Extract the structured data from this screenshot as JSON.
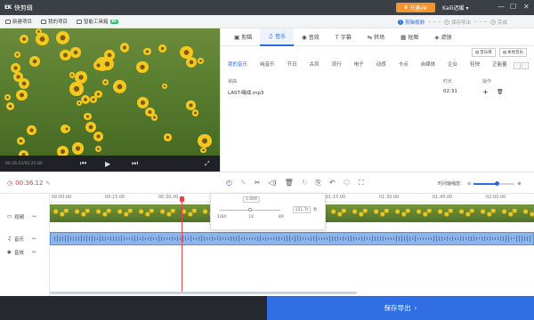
{
  "app": {
    "logo_text": "EK",
    "name": "快剪辑",
    "vip_label": "开通VIP",
    "user_name": "Kaili迟缓",
    "minimize": "—",
    "maximize": "☐",
    "close": "✕"
  },
  "toolbar": {
    "new_project": "新建项目",
    "my_projects": "我的项目",
    "smart_toolbox": "智能工具箱",
    "ai_badge": "AI"
  },
  "steps": [
    {
      "num": "1",
      "label": "剪辑视频",
      "active": true
    },
    {
      "num": "2",
      "label": "保存导出",
      "active": false
    },
    {
      "num": "3",
      "label": "完成",
      "active": false
    }
  ],
  "preview": {
    "timecode": "00:36.12/03:25.80"
  },
  "panel": {
    "tabs": [
      {
        "icon": "▣",
        "label": "剪辑",
        "active": false
      },
      {
        "icon": "♫",
        "label": "音乐",
        "active": true
      },
      {
        "icon": "◉",
        "label": "音效",
        "active": false
      },
      {
        "icon": "T",
        "label": "字幕",
        "active": false
      },
      {
        "icon": "⇆",
        "label": "转场",
        "active": false
      },
      {
        "icon": "▦",
        "label": "抠图",
        "active": false
      },
      {
        "icon": "◈",
        "label": "滤镜",
        "active": false
      }
    ],
    "library_buttons": [
      "音乐库",
      "本地音乐"
    ],
    "subtabs": [
      "我的音乐",
      "纯音乐",
      "节日",
      "古风",
      "流行",
      "电子",
      "动感",
      "卡点",
      "自媒体",
      "企业",
      "轻快",
      "正能量"
    ],
    "music_headers": {
      "name": "歌曲",
      "duration": "时长",
      "action": "操作"
    },
    "music_rows": [
      {
        "name": "LAST-曦成.mp3",
        "duration": "02:31",
        "add": "+",
        "delete": "🗑"
      }
    ]
  },
  "timeline": {
    "current_time": "00:36.12",
    "zoom_label": "时间轴缩放：",
    "zoom_level": 0.55,
    "ruler": [
      "00:00.00",
      "00:15.00",
      "00:30.00",
      "01:15.00",
      "01:30.00",
      "01:45.00",
      "02:00.00"
    ],
    "tracks": {
      "video": "视频",
      "music": "音乐",
      "effect": "音效"
    }
  },
  "speed_popup": {
    "value_top": "1.00X",
    "slider_labels": [
      "1/8X",
      "1X",
      "8X"
    ],
    "input_value": "151.7t",
    "unit": "秒"
  },
  "export": {
    "label": "保存导出",
    "chevron": "›"
  }
}
